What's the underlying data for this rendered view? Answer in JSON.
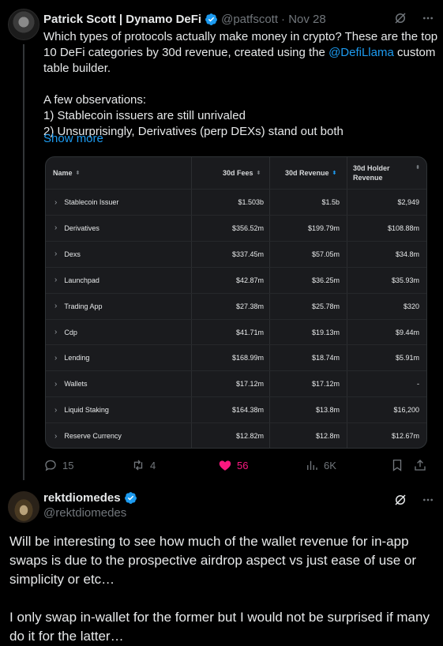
{
  "tweet": {
    "author_name": "Patrick Scott | Dynamo DeFi",
    "author_handle": "@patfscott",
    "date": "· Nov 28",
    "lines": [
      "Which types of protocols actually make money in crypto? These are the top",
      "10 DeFi categories by 30d revenue, created using the",
      "table builder."
    ],
    "mention": "@DefiLlama",
    "mention_suffix": " custom",
    "observations_title": "A few observations:",
    "observation_1": "1) Stablecoin issuers are still unrivaled",
    "observation_2": "2) Unsurprisingly, Derivatives (perp DEXs) stand out both",
    "show_more": "Show more"
  },
  "table": {
    "headers": {
      "name": "Name",
      "fees": "30d Fees",
      "revenue": "30d Revenue",
      "holder_line1": "30d Holder",
      "holder_line2": "Revenue"
    },
    "rows": [
      {
        "name": "Stablecoin Issuer",
        "fees": "$1.503b",
        "revenue": "$1.5b",
        "holder": "$2,949"
      },
      {
        "name": "Derivatives",
        "fees": "$356.52m",
        "revenue": "$199.79m",
        "holder": "$108.88m"
      },
      {
        "name": "Dexs",
        "fees": "$337.45m",
        "revenue": "$57.05m",
        "holder": "$34.8m"
      },
      {
        "name": "Launchpad",
        "fees": "$42.87m",
        "revenue": "$36.25m",
        "holder": "$35.93m"
      },
      {
        "name": "Trading App",
        "fees": "$27.38m",
        "revenue": "$25.78m",
        "holder": "$320"
      },
      {
        "name": "Cdp",
        "fees": "$41.71m",
        "revenue": "$19.13m",
        "holder": "$9.44m"
      },
      {
        "name": "Lending",
        "fees": "$168.99m",
        "revenue": "$18.74m",
        "holder": "$5.91m"
      },
      {
        "name": "Wallets",
        "fees": "$17.12m",
        "revenue": "$17.12m",
        "holder": "-"
      },
      {
        "name": "Liquid Staking",
        "fees": "$164.38m",
        "revenue": "$13.8m",
        "holder": "$16,200"
      },
      {
        "name": "Reserve Currency",
        "fees": "$12.82m",
        "revenue": "$12.8m",
        "holder": "$12.67m"
      }
    ]
  },
  "actions": {
    "replies": "15",
    "reposts": "4",
    "likes": "56",
    "views": "6K"
  },
  "reply": {
    "author_name": "rektdiomedes",
    "author_handle": "@rektdiomedes",
    "lines": [
      "Will be interesting to see how much of the wallet revenue for in-app",
      "swaps is due to the prospective airdrop aspect vs just ease of use or",
      "simplicity or etc…",
      "",
      "I only swap in-wallet for the former but I would not be surprised if many",
      "do it for the latter…"
    ]
  },
  "colors": {
    "accent": "#1d9bf0",
    "like": "#f91880",
    "muted": "#71767b"
  }
}
